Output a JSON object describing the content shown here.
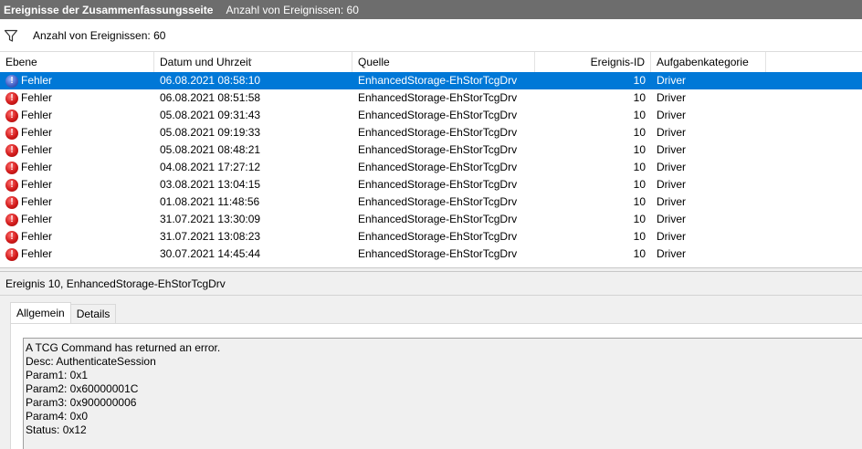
{
  "titlebar": {
    "title": "Ereignisse der Zusammenfassungsseite",
    "count_label": "Anzahl von Ereignissen: 60"
  },
  "filter": {
    "icon": "filter-icon",
    "label": "Anzahl von Ereignissen: 60"
  },
  "columns": [
    "Ebene",
    "Datum und Uhrzeit",
    "Quelle",
    "Ereignis-ID",
    "Aufgabenkategorie"
  ],
  "rows": [
    {
      "level": "Fehler",
      "datetime": "06.08.2021 08:58:10",
      "source": "EnhancedStorage-EhStorTcgDrv",
      "event_id": "10",
      "category": "Driver"
    },
    {
      "level": "Fehler",
      "datetime": "06.08.2021 08:51:58",
      "source": "EnhancedStorage-EhStorTcgDrv",
      "event_id": "10",
      "category": "Driver"
    },
    {
      "level": "Fehler",
      "datetime": "05.08.2021 09:31:43",
      "source": "EnhancedStorage-EhStorTcgDrv",
      "event_id": "10",
      "category": "Driver"
    },
    {
      "level": "Fehler",
      "datetime": "05.08.2021 09:19:33",
      "source": "EnhancedStorage-EhStorTcgDrv",
      "event_id": "10",
      "category": "Driver"
    },
    {
      "level": "Fehler",
      "datetime": "05.08.2021 08:48:21",
      "source": "EnhancedStorage-EhStorTcgDrv",
      "event_id": "10",
      "category": "Driver"
    },
    {
      "level": "Fehler",
      "datetime": "04.08.2021 17:27:12",
      "source": "EnhancedStorage-EhStorTcgDrv",
      "event_id": "10",
      "category": "Driver"
    },
    {
      "level": "Fehler",
      "datetime": "03.08.2021 13:04:15",
      "source": "EnhancedStorage-EhStorTcgDrv",
      "event_id": "10",
      "category": "Driver"
    },
    {
      "level": "Fehler",
      "datetime": "01.08.2021 11:48:56",
      "source": "EnhancedStorage-EhStorTcgDrv",
      "event_id": "10",
      "category": "Driver"
    },
    {
      "level": "Fehler",
      "datetime": "31.07.2021 13:30:09",
      "source": "EnhancedStorage-EhStorTcgDrv",
      "event_id": "10",
      "category": "Driver"
    },
    {
      "level": "Fehler",
      "datetime": "31.07.2021 13:08:23",
      "source": "EnhancedStorage-EhStorTcgDrv",
      "event_id": "10",
      "category": "Driver"
    },
    {
      "level": "Fehler",
      "datetime": "30.07.2021 14:45:44",
      "source": "EnhancedStorage-EhStorTcgDrv",
      "event_id": "10",
      "category": "Driver"
    }
  ],
  "selected_row": 0,
  "detail": {
    "title": "Ereignis 10, EnhancedStorage-EhStorTcgDrv",
    "tabs": [
      "Allgemein",
      "Details"
    ],
    "active_tab": "Allgemein",
    "message_lines": [
      "A TCG Command has returned an error.",
      "Desc: AuthenticateSession",
      "Param1: 0x1",
      "Param2: 0x60000001C",
      "Param3: 0x900000006",
      "Param4: 0x0",
      "Status: 0x12"
    ]
  },
  "colors": {
    "titlebar_bg": "#6d6d6d",
    "selection": "#0078d7",
    "error_icon": "#d11a1a"
  }
}
